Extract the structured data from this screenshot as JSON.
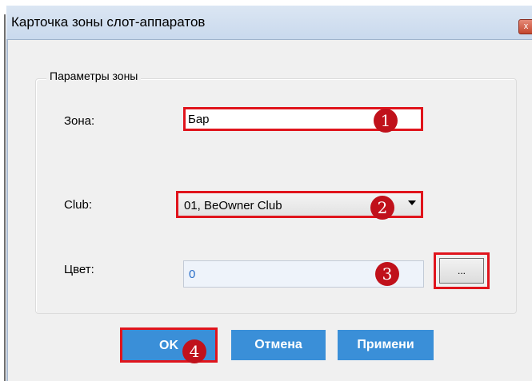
{
  "window": {
    "title": "Карточка зоны слот-аппаратов",
    "close_glyph": "x"
  },
  "group": {
    "legend": "Параметры зоны"
  },
  "zone": {
    "label": "Зона:",
    "value": "Бар"
  },
  "club": {
    "label": "Club:",
    "selected": "01, BeOwner Club"
  },
  "color": {
    "label": "Цвет:",
    "value": "0",
    "picker_label": "..."
  },
  "buttons": {
    "ok": "OK",
    "cancel": "Отмена",
    "apply": "Примени"
  },
  "markers": [
    "1",
    "2",
    "3",
    "4"
  ],
  "colors": {
    "highlight": "#e0141c",
    "marker": "#c0111b",
    "button": "#3a8fd8"
  }
}
